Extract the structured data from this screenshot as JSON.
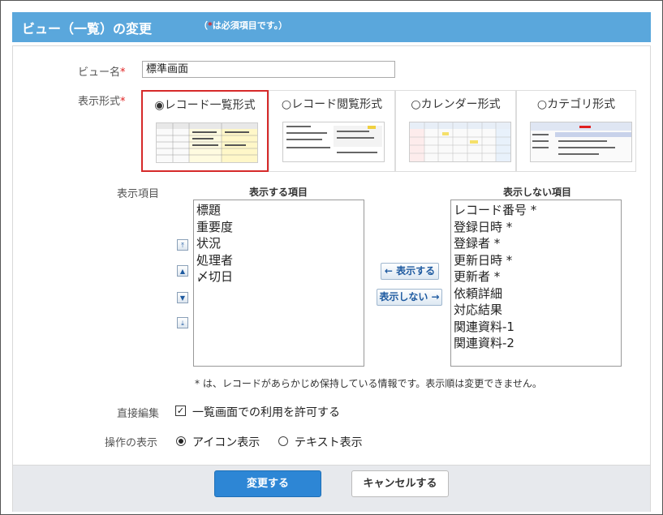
{
  "header": {
    "title": "ビュー（一覧）の変更",
    "note_prefix": "（",
    "note_star": "*",
    "note_suffix": "は必須項目です。）",
    "color": "#5aa7dc"
  },
  "form": {
    "view_name_label": "ビュー名",
    "view_name_value": "標準画面",
    "display_format_label": "表示形式",
    "required_mark": "*",
    "formats": [
      {
        "label": "◉レコード一覧形式",
        "selected": true
      },
      {
        "label": "○レコード閲覧形式",
        "selected": false
      },
      {
        "label": "○カレンダー形式",
        "selected": false
      },
      {
        "label": "○カテゴリ形式",
        "selected": false
      }
    ],
    "display_items_label": "表示項目",
    "shown_title": "表示する項目",
    "hidden_title": "表示しない項目",
    "shown_items": [
      "標題",
      "重要度",
      "状況",
      "処理者",
      "〆切日"
    ],
    "hidden_items": [
      "レコード番号 *",
      "登録日時 *",
      "登録者 *",
      "更新日時 *",
      "更新者 *",
      "依頼詳細",
      "対応結果",
      "関連資料-1",
      "関連資料-2"
    ],
    "order_buttons": {
      "top": "⤒",
      "up": "▲",
      "down": "▼",
      "bottom": "⤓"
    },
    "move_show_label": "← 表示する",
    "move_hide_label": "表示しない →",
    "footnote": "* は、レコードがあらかじめ保持している情報です。表示順は変更できません。",
    "direct_edit_label": "直接編集",
    "direct_edit_option": "一覧画面での利用を許可する",
    "direct_edit_checked": "✓",
    "operation_label": "操作の表示",
    "operation_icon_option": "アイコン表示",
    "operation_text_option": "テキスト表示"
  },
  "footer": {
    "submit_label": "変更する",
    "cancel_label": "キャンセルする",
    "accent": "#2d86d5"
  }
}
